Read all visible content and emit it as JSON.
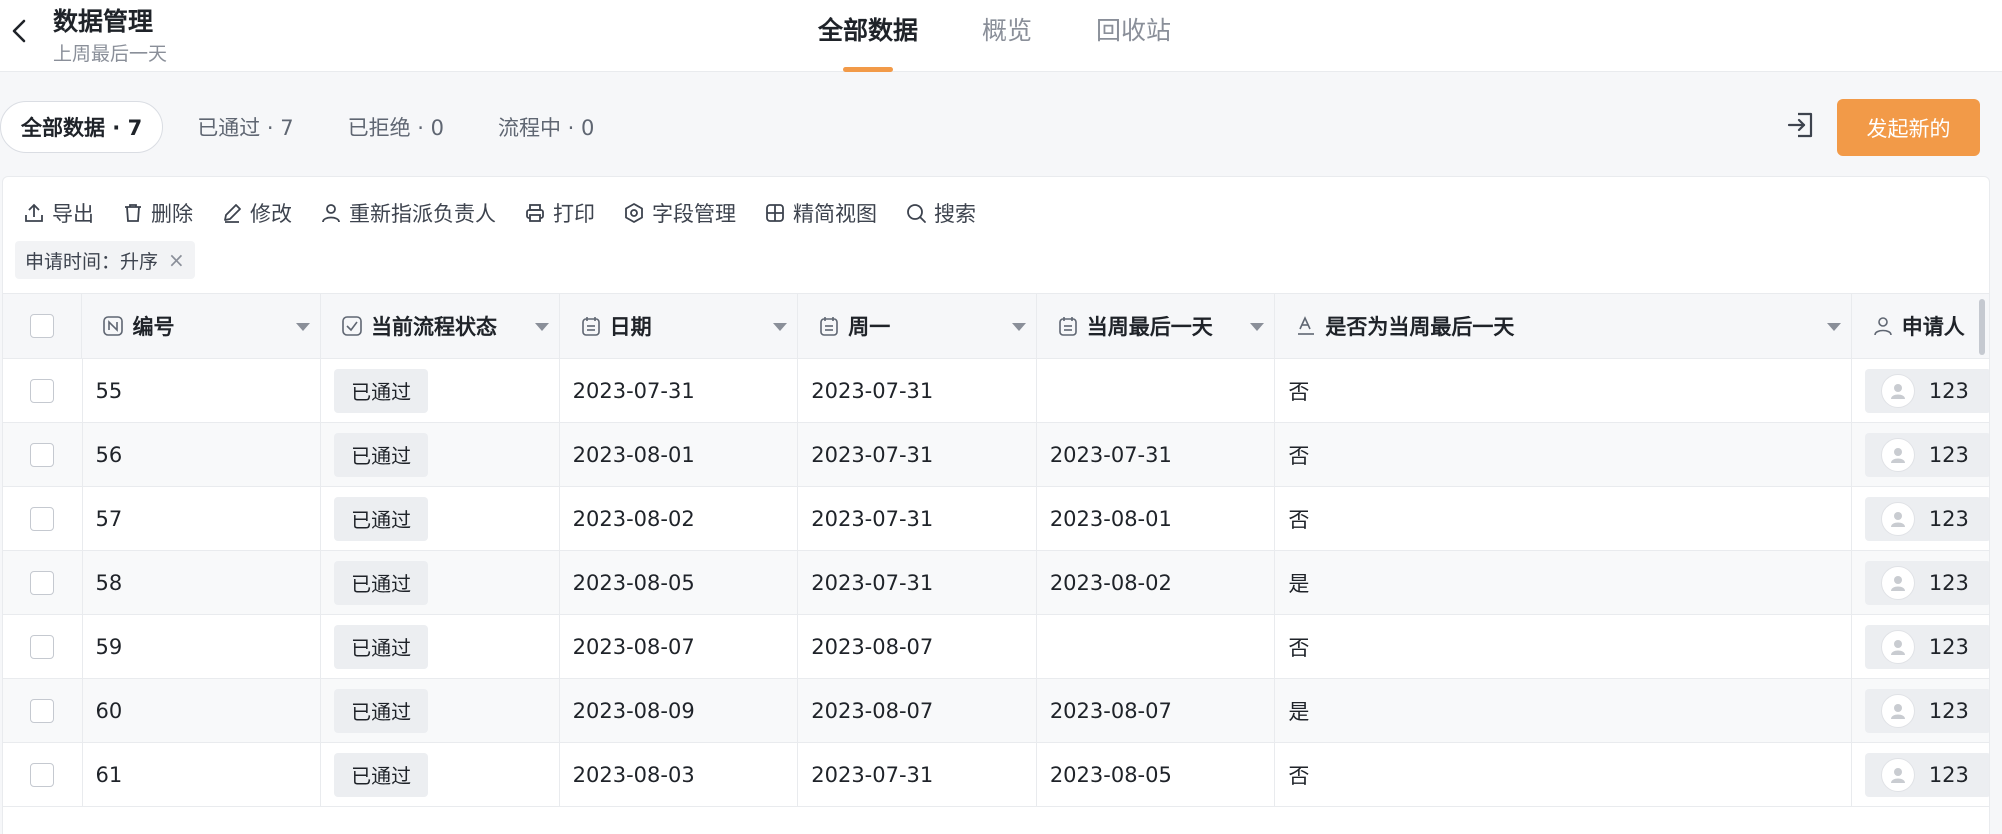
{
  "header": {
    "title": "数据管理",
    "subtitle": "上周最后一天",
    "tabs": [
      {
        "label": "全部数据"
      },
      {
        "label": "概览"
      },
      {
        "label": "回收站"
      }
    ]
  },
  "filters": [
    {
      "label": "全部数据 · 7"
    },
    {
      "label": "已通过 · 7"
    },
    {
      "label": "已拒绝 · 0"
    },
    {
      "label": "流程中 · 0"
    }
  ],
  "start_button": "发起新的",
  "toolbar": {
    "export": "导出",
    "delete": "删除",
    "edit": "修改",
    "reassign": "重新指派负责人",
    "print": "打印",
    "fields": "字段管理",
    "compact": "精简视图",
    "search": "搜索"
  },
  "sort_chip": "申请时间：升序",
  "table": {
    "columns": {
      "id": "编号",
      "status": "当前流程状态",
      "date": "日期",
      "monday": "周一",
      "week_last": "当周最后一天",
      "is_last": "是否为当周最后一天",
      "applicant": "申请人"
    },
    "rows": [
      {
        "id": "55",
        "status": "已通过",
        "date": "2023-07-31",
        "monday": "2023-07-31",
        "week_last": "",
        "is_last": "否",
        "applicant": "123"
      },
      {
        "id": "56",
        "status": "已通过",
        "date": "2023-08-01",
        "monday": "2023-07-31",
        "week_last": "2023-07-31",
        "is_last": "否",
        "applicant": "123"
      },
      {
        "id": "57",
        "status": "已通过",
        "date": "2023-08-02",
        "monday": "2023-07-31",
        "week_last": "2023-08-01",
        "is_last": "否",
        "applicant": "123"
      },
      {
        "id": "58",
        "status": "已通过",
        "date": "2023-08-05",
        "monday": "2023-07-31",
        "week_last": "2023-08-02",
        "is_last": "是",
        "applicant": "123"
      },
      {
        "id": "59",
        "status": "已通过",
        "date": "2023-08-07",
        "monday": "2023-08-07",
        "week_last": "",
        "is_last": "否",
        "applicant": "123"
      },
      {
        "id": "60",
        "status": "已通过",
        "date": "2023-08-09",
        "monday": "2023-08-07",
        "week_last": "2023-08-07",
        "is_last": "是",
        "applicant": "123"
      },
      {
        "id": "61",
        "status": "已通过",
        "date": "2023-08-03",
        "monday": "2023-07-31",
        "week_last": "2023-08-05",
        "is_last": "否",
        "applicant": "123"
      }
    ]
  },
  "colors": {
    "accent": "#f29a48",
    "text": "#1f2329",
    "muted": "#8a8f99"
  }
}
